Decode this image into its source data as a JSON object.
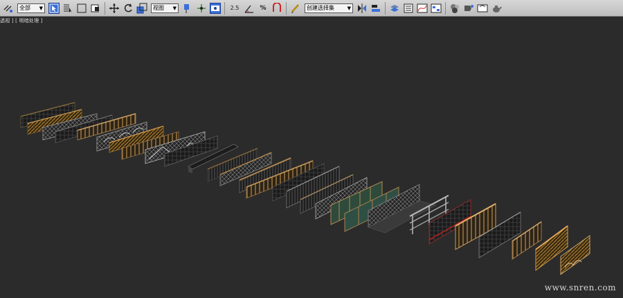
{
  "toolbar": {
    "selection_filter": "全部",
    "coord_system": "视图",
    "named_selection": "创建选择集",
    "snap_value": "2.5",
    "percent_label": "%"
  },
  "viewport": {
    "label": "透视 ] [ 明暗处理 ]",
    "watermark": "www.snren.com",
    "background": "#2b2b2b"
  },
  "colors": {
    "toolbar_bg": "#cfcfcf",
    "active_tool": "#3a6fd8"
  }
}
